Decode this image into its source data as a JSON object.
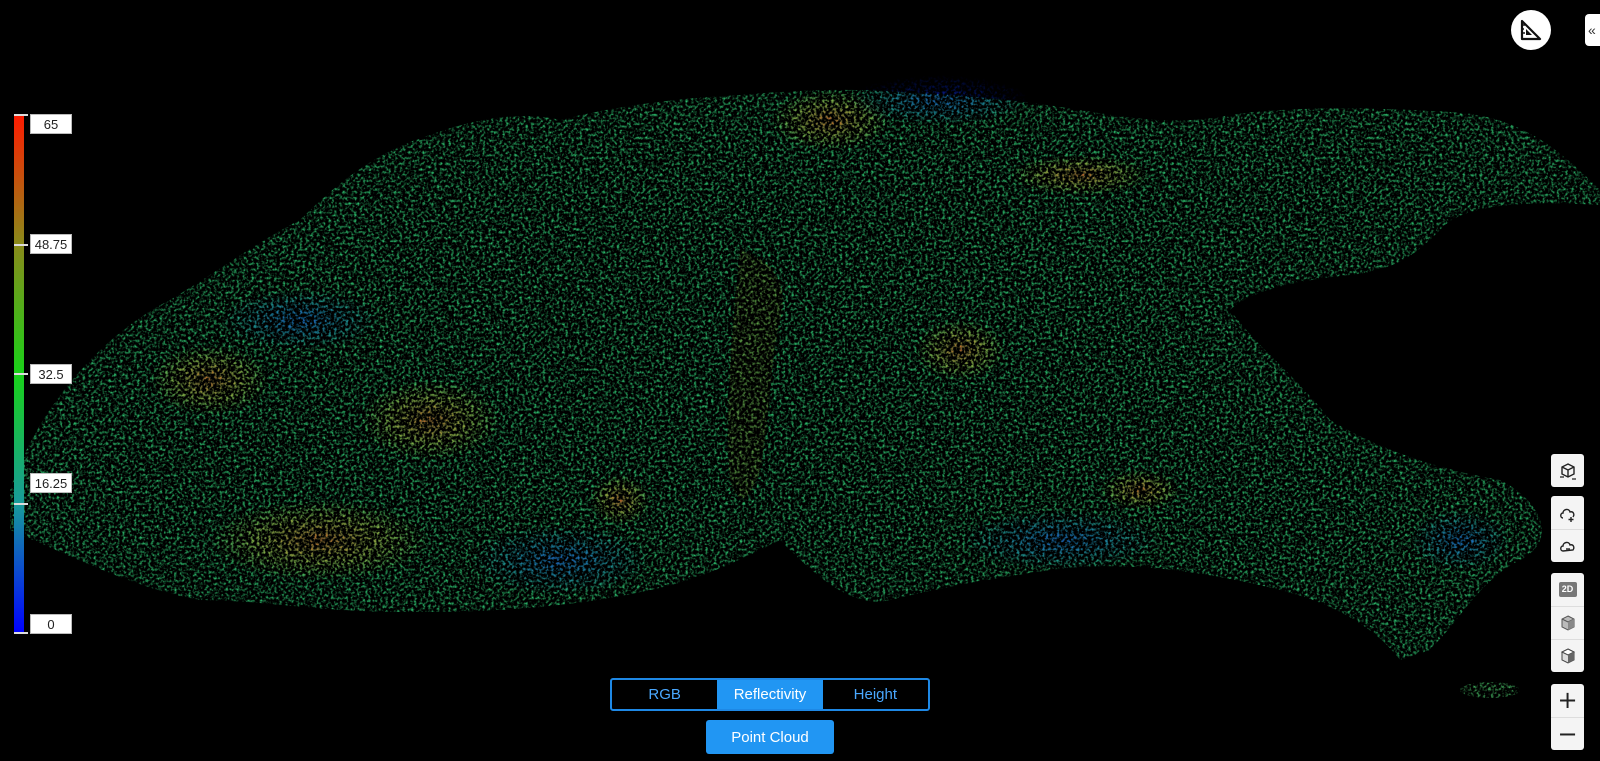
{
  "legend": {
    "labels": [
      "65",
      "48.75",
      "32.5",
      "16.25",
      "0"
    ],
    "colors": [
      "#ff1a00",
      "#8a8a1a",
      "#19d219",
      "#189b9b",
      "#0000ff"
    ]
  },
  "modes": {
    "tabs": [
      "RGB",
      "Reflectivity",
      "Height"
    ],
    "active": "Reflectivity"
  },
  "point_cloud_label": "Point Cloud",
  "collapse_glyph": "«",
  "toolbar": {
    "badge_2d": "2D",
    "zoom_in": "+",
    "zoom_out": "−"
  },
  "palette": {
    "accent": "#2196f3",
    "background": "#000000"
  }
}
